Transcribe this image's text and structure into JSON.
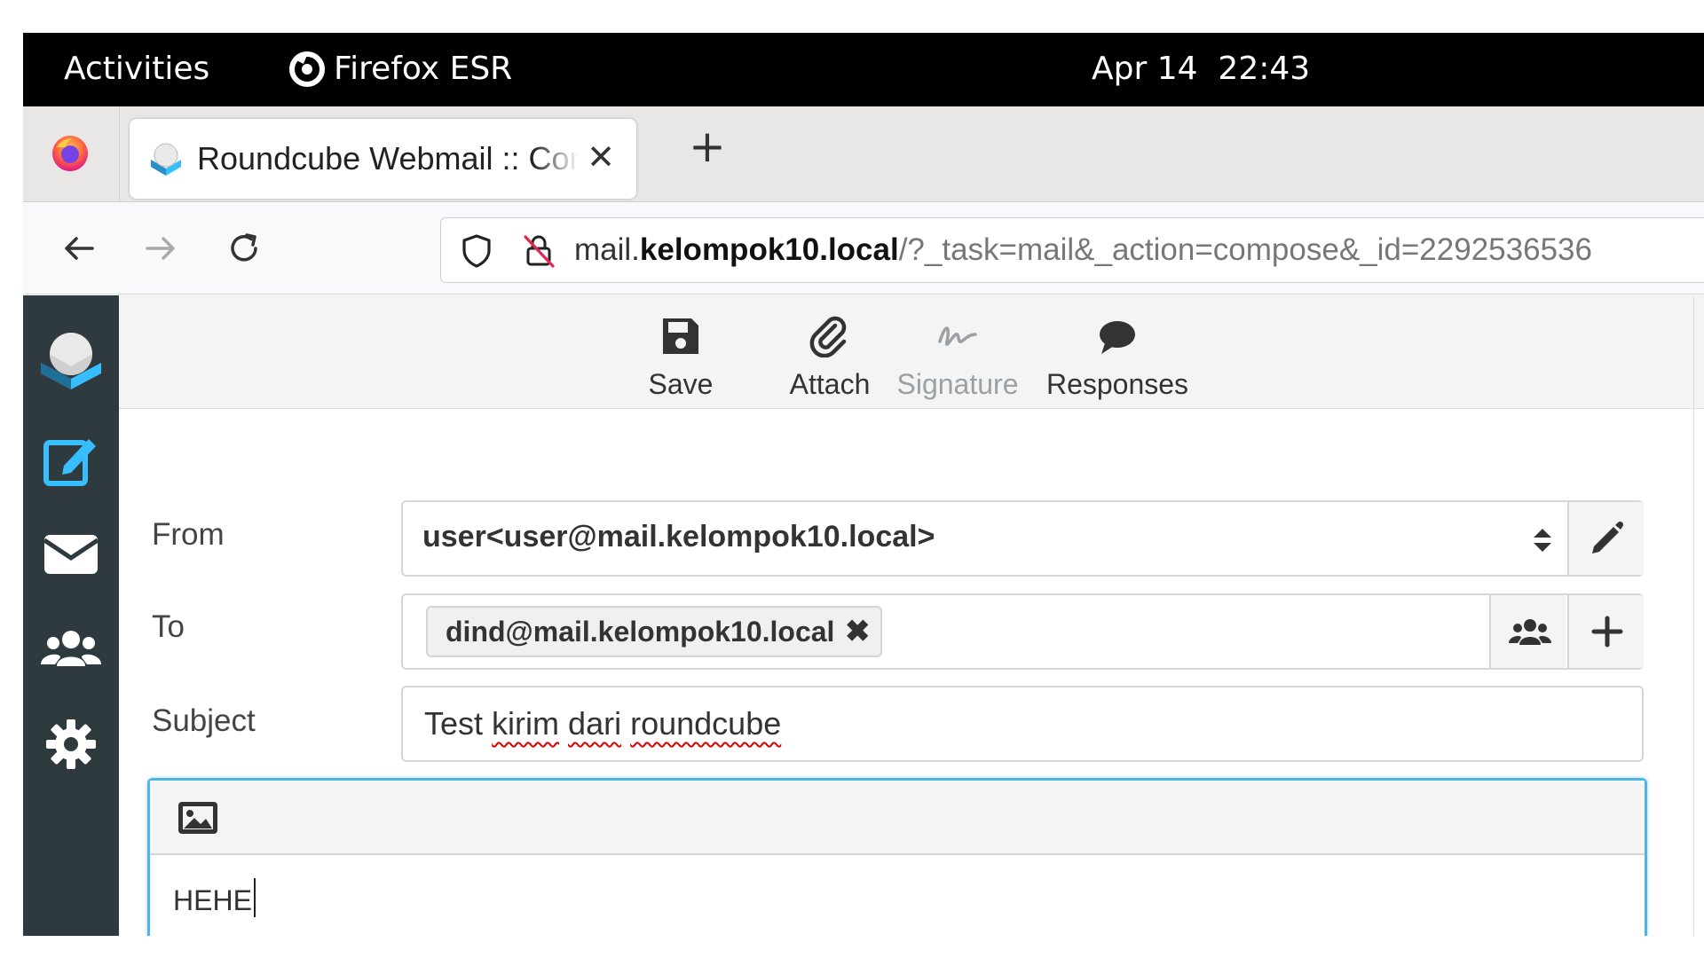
{
  "system_bar": {
    "activities": "Activities",
    "app_name": "Firefox ESR",
    "clock": "Apr 14  22:43"
  },
  "browser": {
    "tab_title": "Roundcube Webmail :: Compose",
    "new_tab_symbol": "+",
    "close_tab_symbol": "✕",
    "url_prefix": "mail.",
    "url_host": "kelompok10.local",
    "url_path": "/?_task=mail&_action=compose&_id=2292536536"
  },
  "toolbar": {
    "save": "Save",
    "attach": "Attach",
    "signature": "Signature",
    "responses": "Responses"
  },
  "compose": {
    "from_label": "From",
    "from_value": "user<user@mail.kelompok10.local>",
    "to_label": "To",
    "to_recipient": "dind@mail.kelompok10.local",
    "subject_label": "Subject",
    "subject_words": [
      "Test",
      "kirim",
      "dari",
      "roundcube"
    ],
    "body": "HEHE"
  },
  "colors": {
    "sidebar_bg": "#2f3a3f",
    "accent": "#37beff",
    "editor_focus": "#4fb4e4"
  },
  "icons": {
    "sidebar": [
      "roundcube-logo",
      "compose-icon",
      "mail-icon",
      "contacts-icon",
      "settings-icon"
    ],
    "toolbar": [
      "save-icon",
      "attach-icon",
      "signature-icon",
      "responses-icon"
    ]
  }
}
